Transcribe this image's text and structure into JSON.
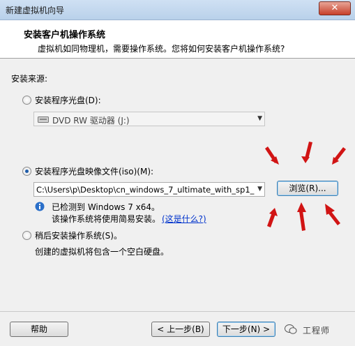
{
  "window": {
    "title": "新建虚拟机向导",
    "close_glyph": "✕"
  },
  "header": {
    "title": "安装客户机操作系统",
    "subtitle": "虚拟机如同物理机，需要操作系统。您将如何安装客户机操作系统?"
  },
  "source": {
    "label": "安装来源:",
    "options": [
      {
        "label": "安装程序光盘(D):",
        "selected": false
      },
      {
        "label": "安装程序光盘映像文件(iso)(M):",
        "selected": true
      },
      {
        "label": "稍后安装操作系统(S)。",
        "selected": false
      }
    ],
    "disc_drive": {
      "value": "DVD RW 驱动器 (J:)",
      "icon": "dvd-drive-icon"
    },
    "iso_path": {
      "value": "C:\\Users\\p\\Desktop\\cn_windows_7_ultimate_with_sp1_"
    },
    "browse_label": "浏览(R)...",
    "detected": {
      "icon": "info-icon",
      "line1": "已检测到 Windows 7 x64。",
      "line2": "该操作系统将使用简易安装。",
      "link": "(这是什么?)"
    },
    "later_desc": "创建的虚拟机将包含一个空白硬盘。"
  },
  "footer": {
    "help_label": "帮助",
    "back_label": "< 上一步(B)",
    "next_label": "下一步(N) >",
    "watermark": "工程师"
  },
  "colors": {
    "annotation_arrow": "#d11414",
    "link": "#0033cc"
  }
}
